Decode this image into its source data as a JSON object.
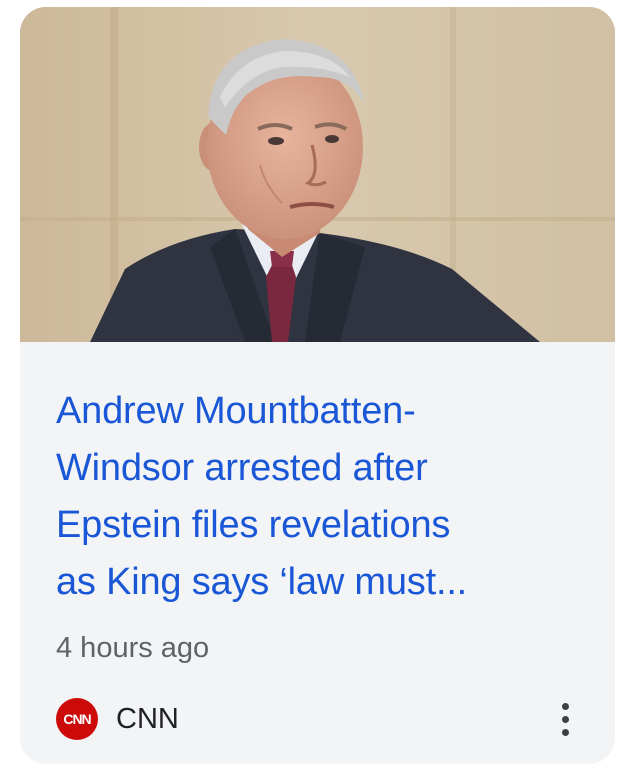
{
  "article": {
    "headline_lines": [
      "Andrew Mountbatten-",
      "Windsor arrested after",
      "Epstein files revelations",
      "as King says ‘law must..."
    ],
    "timestamp": "4 hours ago",
    "source": {
      "logo_text": "CNN",
      "name": "CNN"
    }
  },
  "colors": {
    "headline": "#1a57d6",
    "card_background": "#f3f4f6",
    "logo_background": "#cc0a0a"
  },
  "icons": {
    "more": "more-vert-icon"
  }
}
